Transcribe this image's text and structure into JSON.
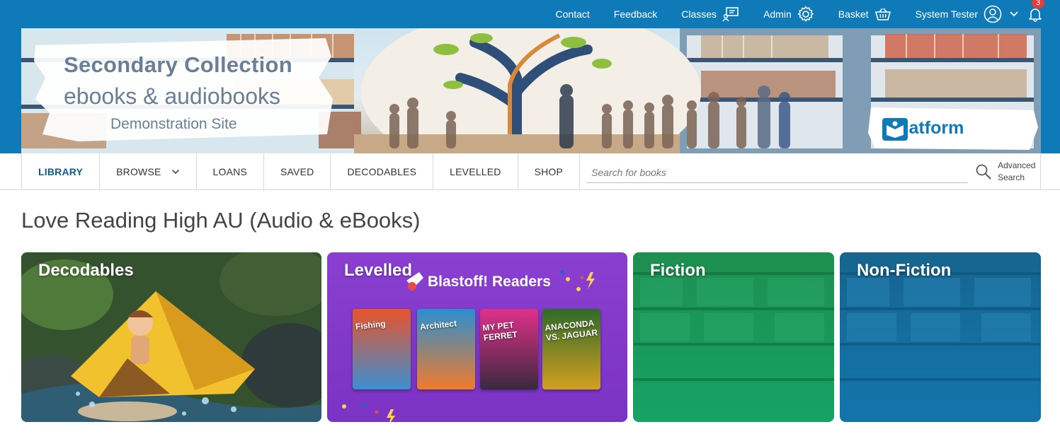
{
  "topnav": {
    "contact": "Contact",
    "feedback": "Feedback",
    "classes": "Classes",
    "admin": "Admin",
    "basket": "Basket",
    "user": "System Tester",
    "notifications": "3"
  },
  "banner": {
    "title": "Secondary Collection",
    "subtitle": "ebooks & audiobooks",
    "site": "Demonstration Site",
    "logo": "ePlatform"
  },
  "nav": {
    "library": "LIBRARY",
    "browse": "BROWSE",
    "loans": "LOANS",
    "saved": "SAVED",
    "decodables": "DECODABLES",
    "levelled": "LEVELLED",
    "shop": "SHOP",
    "search_placeholder": "Search for books",
    "advanced_search": "Advanced Search"
  },
  "page": {
    "title": "Love Reading High AU (Audio & eBooks)"
  },
  "tiles": [
    {
      "label": "Decodables"
    },
    {
      "label": "Levelled",
      "banner": "Blastoff! Readers",
      "books": [
        "Fishing",
        "Architect",
        "MY PET FERRET",
        "ANACONDA VS. JAGUAR"
      ]
    },
    {
      "label": "Fiction"
    },
    {
      "label": "Non-Fiction"
    }
  ],
  "colors": {
    "brand_blue": "#0f7ab8",
    "nav_active": "#125a86",
    "badge": "#e63b3b",
    "levelled_purple": "#7a33c4",
    "fiction_green": "#179a5b",
    "nonfiction_blue": "#146fa0"
  },
  "icons": [
    "classes-icon",
    "gear-icon",
    "basket-icon",
    "user-avatar-icon",
    "chevron-down-icon",
    "bell-icon",
    "search-icon",
    "eplatform-logo-icon"
  ]
}
